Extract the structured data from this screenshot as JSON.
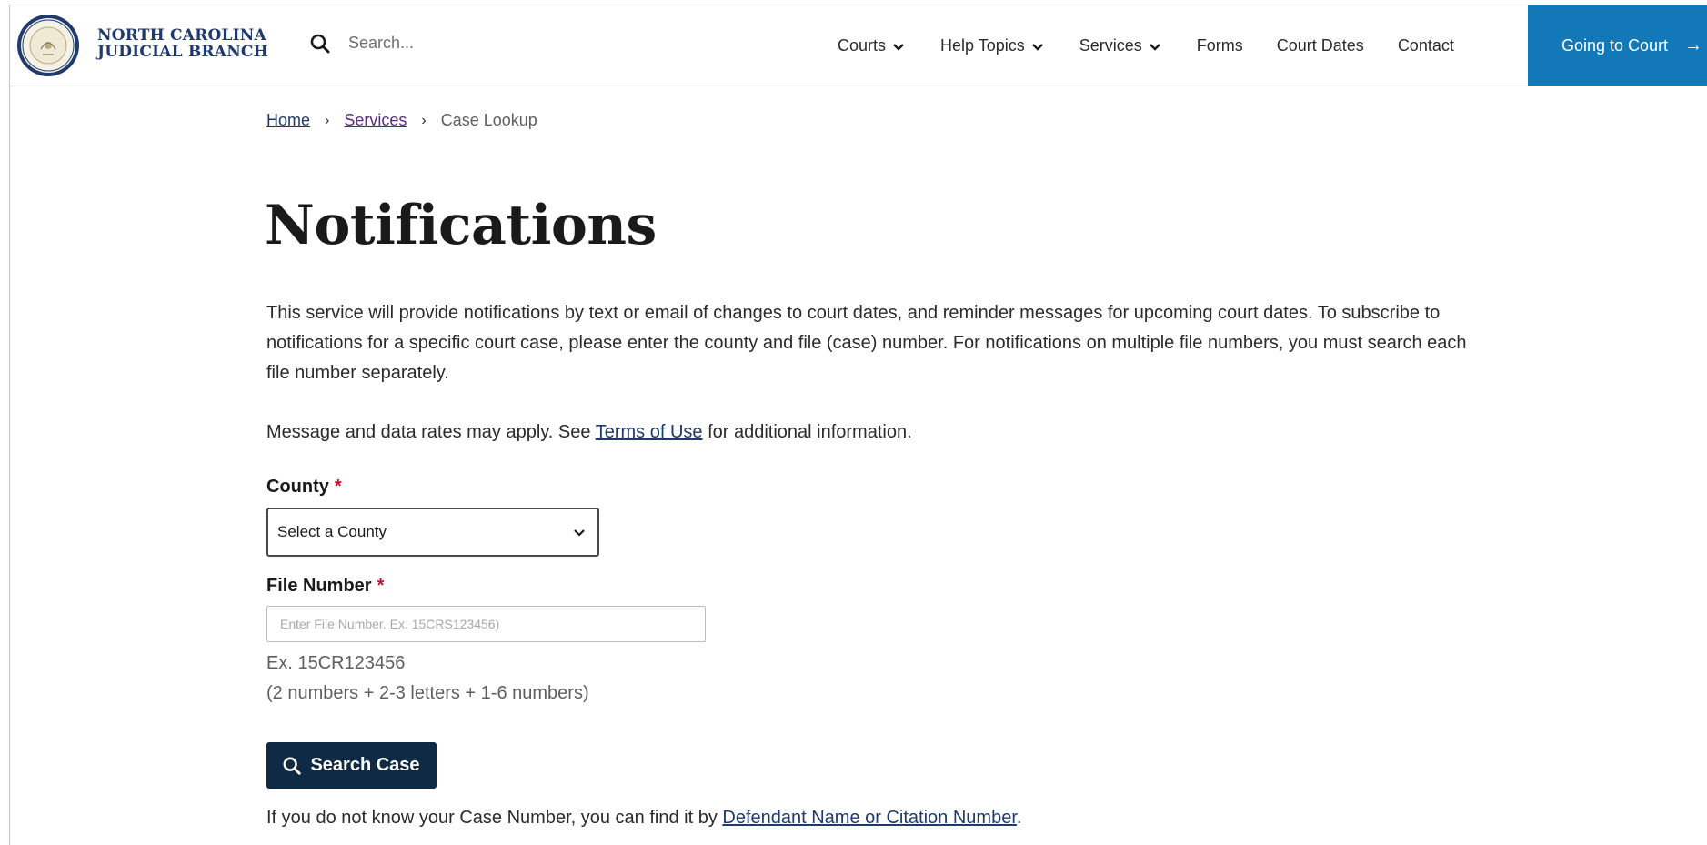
{
  "header": {
    "brand_line1": "NORTH CAROLINA",
    "brand_line2": "JUDICIAL BRANCH",
    "logo_icon": "state-seal",
    "search_placeholder": "Search...",
    "nav": [
      {
        "label": "Courts",
        "has_dropdown": true
      },
      {
        "label": "Help Topics",
        "has_dropdown": true
      },
      {
        "label": "Services",
        "has_dropdown": true
      },
      {
        "label": "Forms",
        "has_dropdown": false
      },
      {
        "label": "Court Dates",
        "has_dropdown": false
      },
      {
        "label": "Contact",
        "has_dropdown": false
      }
    ],
    "cta_label": "Going to Court",
    "cta_arrow": "→",
    "cta_color": "#1378b8"
  },
  "breadcrumb": {
    "home": "Home",
    "services": "Services",
    "current": "Case Lookup",
    "separator": "›"
  },
  "page": {
    "title": "Notifications",
    "intro": "This service will provide notifications by text or email of changes to court dates, and reminder messages for upcoming court dates. To subscribe to notifications for a specific court case, please enter the county and file (case) number. For notifications on multiple file numbers, you must search each file number separately.",
    "rates_prefix": "Message and data rates may apply. See ",
    "rates_link": "Terms of Use",
    "rates_suffix": " for additional information."
  },
  "form": {
    "county_label": "County",
    "required_mark": "*",
    "county_selected": "Select a County",
    "file_label": "File Number",
    "file_placeholder": "Enter File Number. Ex. 15CRS123456)",
    "hint_line1": "Ex. 15CR123456",
    "hint_line2": "(2 numbers + 2-3 letters + 1-6 numbers)",
    "submit_label": "Search Case",
    "button_color": "#0f2a44",
    "required_color": "#c8102e"
  },
  "footer_note": {
    "prefix": "If you do not know your Case Number, you can find it by ",
    "link": "Defendant Name or Citation Number",
    "suffix": "."
  }
}
